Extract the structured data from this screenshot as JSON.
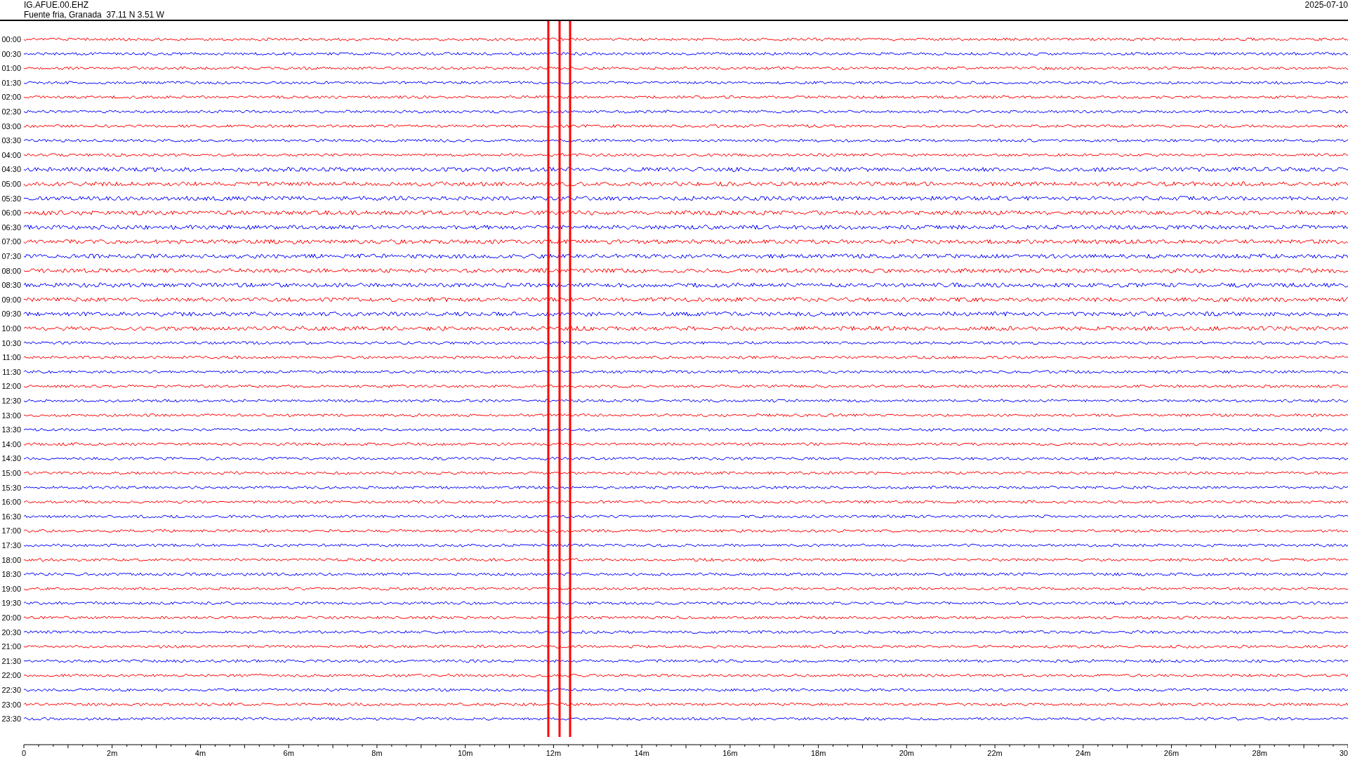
{
  "header": {
    "station": "IG.AFUE.00.EHZ",
    "location": "Fuente fria, Granada  37.11 N 3.51 W",
    "date": "2025-07-10"
  },
  "traces": [
    {
      "label": "00:00",
      "color": "#ff0000"
    },
    {
      "label": "00:30",
      "color": "#0000ff"
    },
    {
      "label": "01:00",
      "color": "#ff0000"
    },
    {
      "label": "01:30",
      "color": "#0000ff"
    },
    {
      "label": "02:00",
      "color": "#ff0000"
    },
    {
      "label": "02:30",
      "color": "#0000ff"
    },
    {
      "label": "03:00",
      "color": "#ff0000"
    },
    {
      "label": "03:30",
      "color": "#0000ff"
    },
    {
      "label": "04:00",
      "color": "#ff0000"
    },
    {
      "label": "04:30",
      "color": "#0000ff"
    },
    {
      "label": "05:00",
      "color": "#ff0000"
    },
    {
      "label": "05:30",
      "color": "#0000ff"
    },
    {
      "label": "06:00",
      "color": "#ff0000"
    },
    {
      "label": "06:30",
      "color": "#0000ff"
    },
    {
      "label": "07:00",
      "color": "#ff0000"
    },
    {
      "label": "07:30",
      "color": "#0000ff"
    },
    {
      "label": "08:00",
      "color": "#ff0000"
    },
    {
      "label": "08:30",
      "color": "#0000ff"
    },
    {
      "label": "09:00",
      "color": "#ff0000"
    },
    {
      "label": "09:30",
      "color": "#0000ff"
    },
    {
      "label": "10:00",
      "color": "#ff0000"
    },
    {
      "label": "10:30",
      "color": "#0000ff"
    },
    {
      "label": "11:00",
      "color": "#ff0000"
    },
    {
      "label": "11:30",
      "color": "#0000ff"
    },
    {
      "label": "12:00",
      "color": "#ff0000"
    },
    {
      "label": "12:30",
      "color": "#0000ff"
    },
    {
      "label": "13:00",
      "color": "#ff0000"
    },
    {
      "label": "13:30",
      "color": "#0000ff"
    },
    {
      "label": "14:00",
      "color": "#ff0000"
    },
    {
      "label": "14:30",
      "color": "#0000ff"
    },
    {
      "label": "15:00",
      "color": "#ff0000"
    },
    {
      "label": "15:30",
      "color": "#0000ff"
    },
    {
      "label": "16:00",
      "color": "#ff0000"
    },
    {
      "label": "16:30",
      "color": "#0000ff"
    },
    {
      "label": "17:00",
      "color": "#ff0000"
    },
    {
      "label": "17:30",
      "color": "#0000ff"
    },
    {
      "label": "18:00",
      "color": "#ff0000"
    },
    {
      "label": "18:30",
      "color": "#0000ff"
    },
    {
      "label": "19:00",
      "color": "#ff0000"
    },
    {
      "label": "19:30",
      "color": "#0000ff"
    },
    {
      "label": "20:00",
      "color": "#ff0000"
    },
    {
      "label": "20:30",
      "color": "#0000ff"
    },
    {
      "label": "21:00",
      "color": "#ff0000"
    },
    {
      "label": "21:30",
      "color": "#0000ff"
    },
    {
      "label": "22:00",
      "color": "#ff0000"
    },
    {
      "label": "22:30",
      "color": "#0000ff"
    },
    {
      "label": "23:00",
      "color": "#ff0000"
    },
    {
      "label": "23:30",
      "color": "#0000ff"
    }
  ],
  "axis_labels": [
    "0",
    "2m",
    "4m",
    "6m",
    "8m",
    "10m",
    "12m",
    "14m",
    "16m",
    "18m",
    "20m",
    "22m",
    "24m",
    "26m",
    "28m",
    "30"
  ]
}
